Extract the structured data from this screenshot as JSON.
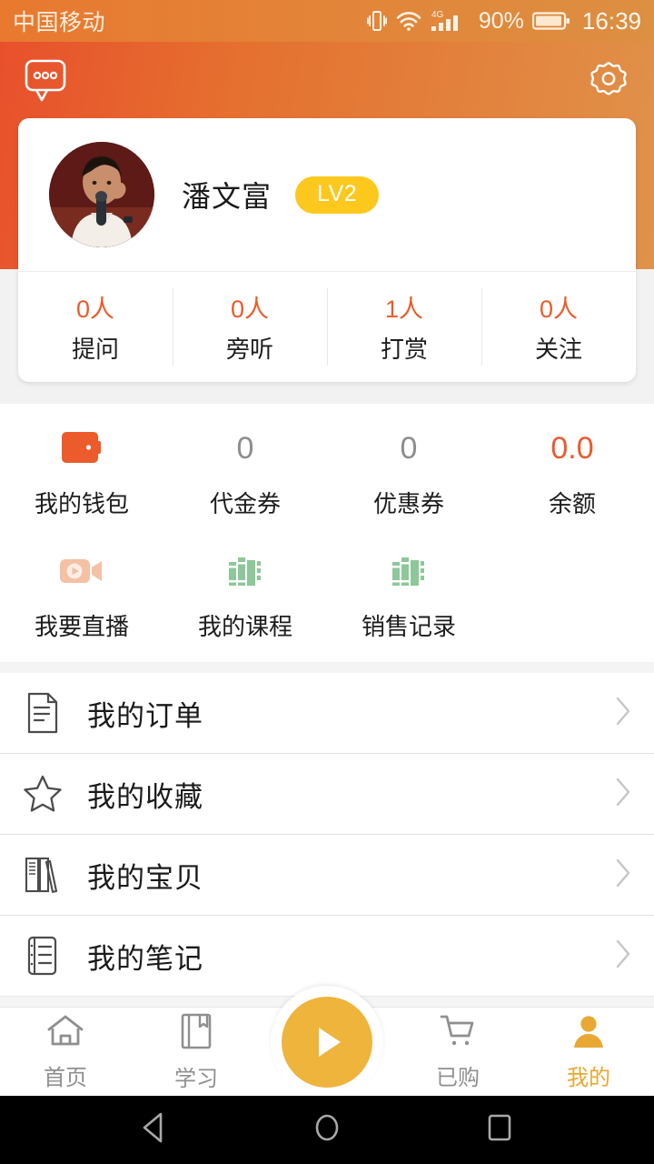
{
  "status_bar": {
    "carrier": "中国移动",
    "network_type": "4G",
    "battery_percent": "90%",
    "time": "16:39",
    "icons": [
      "vibrate-icon",
      "wifi-icon",
      "signal-icon",
      "battery-icon"
    ]
  },
  "header": {
    "left_icon": "message-bubble-icon",
    "right_icon": "gear-icon",
    "gradient_from": "#e8502c",
    "gradient_to": "#e0924a"
  },
  "profile": {
    "avatar": "user-avatar-photo",
    "name": "潘文富",
    "level_badge": "LV2",
    "badge_color": "#fcc81d",
    "stats": [
      {
        "value": "0人",
        "label": "提问"
      },
      {
        "value": "0人",
        "label": "旁听"
      },
      {
        "value": "1人",
        "label": "打赏"
      },
      {
        "value": "0人",
        "label": "关注"
      }
    ],
    "stat_value_color": "#ec5b2b"
  },
  "grid": {
    "row1": [
      {
        "icon": "wallet-icon",
        "value": "",
        "label": "我的钱包",
        "accent": true
      },
      {
        "icon": "",
        "value": "0",
        "label": "代金券",
        "accent": false
      },
      {
        "icon": "",
        "value": "0",
        "label": "优惠券",
        "accent": false
      },
      {
        "icon": "",
        "value": "0.0",
        "label": "余额",
        "accent": true
      }
    ],
    "row2": [
      {
        "icon": "video-camera-icon",
        "label": "我要直播"
      },
      {
        "icon": "books-icon",
        "label": "我的课程"
      },
      {
        "icon": "books-icon",
        "label": "销售记录"
      }
    ]
  },
  "menu": [
    {
      "icon": "document-icon",
      "label": "我的订单",
      "arrow": "chevron-right-icon"
    },
    {
      "icon": "star-icon",
      "label": "我的收藏",
      "arrow": "chevron-right-icon"
    },
    {
      "icon": "bookshelf-icon",
      "label": "我的宝贝",
      "arrow": "chevron-right-icon"
    },
    {
      "icon": "notebook-icon",
      "label": "我的笔记",
      "arrow": "chevron-right-icon"
    }
  ],
  "tabbar": {
    "items": [
      {
        "icon": "home-icon",
        "label": "首页",
        "active": false
      },
      {
        "icon": "book-icon",
        "label": "学习",
        "active": false
      },
      {
        "icon": "play-icon",
        "label": "",
        "active": false
      },
      {
        "icon": "cart-icon",
        "label": "已购",
        "active": false
      },
      {
        "icon": "person-icon",
        "label": "我的",
        "active": true
      }
    ],
    "active_color": "#e8a833",
    "inactive_color": "#8f8f8f",
    "fab_icon": "play-icon",
    "fab_color": "#eeb43c"
  },
  "android_nav": {
    "back": "back-triangle-icon",
    "home": "home-circle-icon",
    "recents": "recents-square-icon"
  }
}
